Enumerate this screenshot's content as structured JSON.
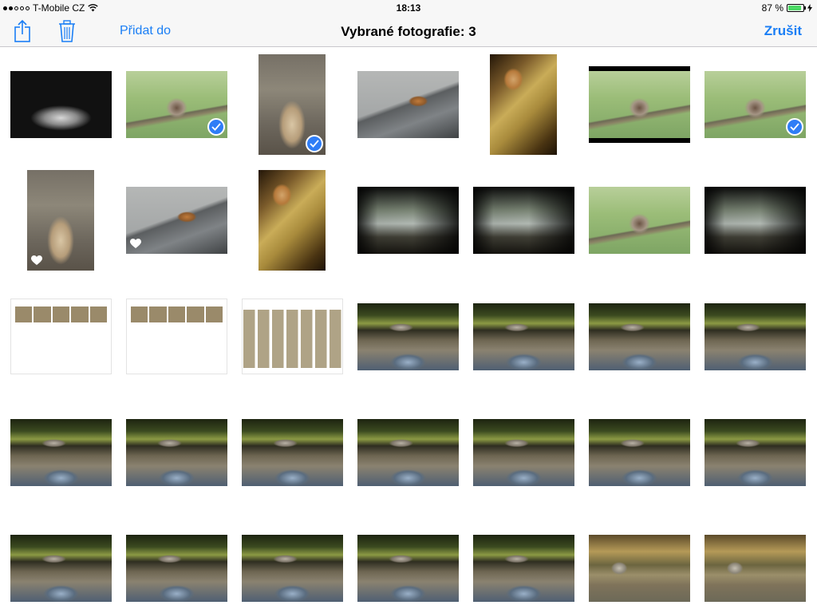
{
  "status_bar": {
    "carrier": "T-Mobile CZ",
    "time": "18:13",
    "battery_percent": "87 %",
    "battery_level": 0.87
  },
  "nav": {
    "share_icon": "share-icon",
    "trash_icon": "trash-icon",
    "add_to_label": "Přidat do",
    "title": "Vybrané fotografie: 3",
    "cancel_label": "Zrušit"
  },
  "colors": {
    "accent": "#1a7ef5",
    "check": "#2f7df6",
    "battery": "#4cd964"
  },
  "photos": [
    {
      "kind": "hands",
      "selected": false,
      "favorite": false
    },
    {
      "kind": "bird",
      "selected": true,
      "favorite": false
    },
    {
      "kind": "monkey",
      "selected": true,
      "favorite": false
    },
    {
      "kind": "squirrel",
      "selected": false,
      "favorite": false
    },
    {
      "kind": "iguana",
      "selected": false,
      "favorite": false
    },
    {
      "kind": "bird",
      "selected": false,
      "favorite": false
    },
    {
      "kind": "bird",
      "selected": true,
      "favorite": false
    },
    {
      "kind": "monkey",
      "selected": false,
      "favorite": true
    },
    {
      "kind": "squirrel",
      "selected": false,
      "favorite": true
    },
    {
      "kind": "iguana",
      "selected": false,
      "favorite": false
    },
    {
      "kind": "room",
      "selected": false,
      "favorite": false
    },
    {
      "kind": "room",
      "selected": false,
      "favorite": false
    },
    {
      "kind": "bird",
      "selected": false,
      "favorite": false
    },
    {
      "kind": "room",
      "selected": false,
      "favorite": false
    },
    {
      "kind": "screenshot",
      "selected": false,
      "favorite": false
    },
    {
      "kind": "screenshot",
      "selected": false,
      "favorite": false
    },
    {
      "kind": "screenshot-grid",
      "selected": false,
      "favorite": false
    },
    {
      "kind": "otter",
      "selected": false,
      "favorite": false
    },
    {
      "kind": "otter",
      "selected": false,
      "favorite": false
    },
    {
      "kind": "otter",
      "selected": false,
      "favorite": false
    },
    {
      "kind": "otter",
      "selected": false,
      "favorite": false
    },
    {
      "kind": "otter",
      "selected": false,
      "favorite": false
    },
    {
      "kind": "otter",
      "selected": false,
      "favorite": false
    },
    {
      "kind": "otter",
      "selected": false,
      "favorite": false
    },
    {
      "kind": "otter",
      "selected": false,
      "favorite": false
    },
    {
      "kind": "otter",
      "selected": false,
      "favorite": false
    },
    {
      "kind": "otter",
      "selected": false,
      "favorite": false
    },
    {
      "kind": "otter",
      "selected": false,
      "favorite": false
    },
    {
      "kind": "otter",
      "selected": false,
      "favorite": false
    },
    {
      "kind": "otter",
      "selected": false,
      "favorite": false
    },
    {
      "kind": "otter",
      "selected": false,
      "favorite": false
    },
    {
      "kind": "otter",
      "selected": false,
      "favorite": false
    },
    {
      "kind": "otter",
      "selected": false,
      "favorite": false
    },
    {
      "kind": "fox",
      "selected": false,
      "favorite": false
    },
    {
      "kind": "fox",
      "selected": false,
      "favorite": false
    }
  ]
}
